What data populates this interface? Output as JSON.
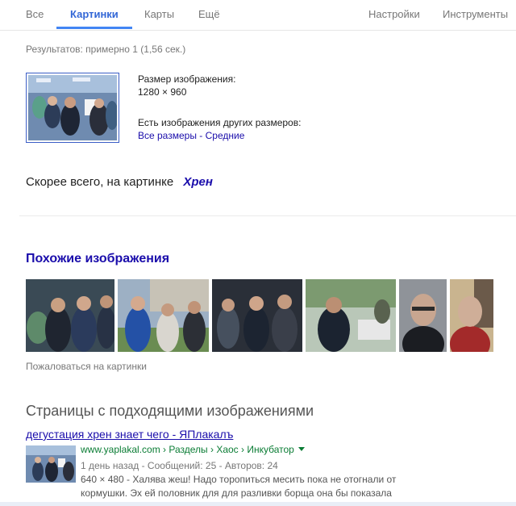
{
  "nav": {
    "tabs": [
      {
        "label": "Все"
      },
      {
        "label": "Картинки"
      },
      {
        "label": "Карты"
      },
      {
        "label": "Ещё"
      }
    ],
    "settings": "Настройки",
    "tools": "Инструменты"
  },
  "results_count": "Результатов: примерно 1 (1,56 сек.)",
  "image_info": {
    "size_label": "Размер изображения:",
    "size_value": "1280 × 960",
    "other_sizes_label": "Есть изображения других размеров:",
    "all_sizes": "Все размеры",
    "separator": "-",
    "medium": "Средние"
  },
  "best_guess": {
    "prefix": "Скорее всего, на картинке",
    "term": "Хрен"
  },
  "similar": {
    "title": "Похожие изображения",
    "report": "Пожаловаться на картинки"
  },
  "pages": {
    "title": "Страницы с подходящими изображениями",
    "results": [
      {
        "title": "дегустация хрен знает чего - ЯПлакалъ",
        "url": "www.yaplakal.com › Разделы › Хаос › Инкубатор",
        "meta": "1 день назад - Сообщений: 25 - Авторов: 24",
        "snippet": "640 × 480 - Халява жеш! Надо торопиться месить пока не отогнали от кормушки. Эх ей половник для для разливки борща она бы показала"
      }
    ]
  },
  "colors": {
    "link": "#1a0dab",
    "accent": "#4285f4",
    "url_green": "#0a7c34"
  }
}
